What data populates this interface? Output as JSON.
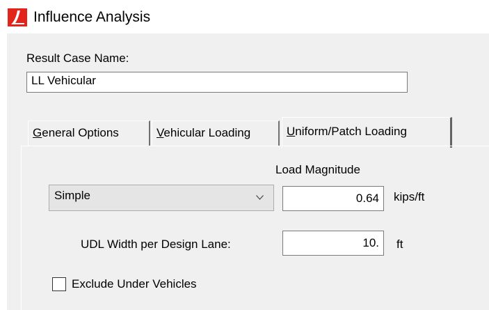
{
  "window": {
    "title": "Influence Analysis",
    "icon": "app-logo-icon"
  },
  "result_case": {
    "label": "Result Case Name:",
    "value": "LL Vehicular"
  },
  "tabs": [
    {
      "label": "General Options",
      "mnemonic": "G",
      "rest": "eneral Options",
      "active": false
    },
    {
      "label": "Vehicular Loading",
      "mnemonic": "V",
      "rest": "ehicular Loading",
      "active": false
    },
    {
      "label": "Uniform/Patch Loading",
      "mnemonic": "U",
      "rest": "niform/Patch Loading",
      "active": true
    }
  ],
  "uniform_patch": {
    "load_magnitude_label": "Load Magnitude",
    "load_type": {
      "selected": "Simple",
      "icon": "chevron-down-icon"
    },
    "load_magnitude_value": "0.64",
    "load_magnitude_unit": "kips/ft",
    "udl_width_label": "UDL Width per Design Lane:",
    "udl_width_value": "10.",
    "udl_width_unit": "ft",
    "exclude_under_vehicles": {
      "label": "Exclude Under Vehicles",
      "checked": false
    }
  },
  "colors": {
    "dialog_bg": "#f0f0f0",
    "icon_red": "#e3241b",
    "border": "#7a7a7a"
  }
}
